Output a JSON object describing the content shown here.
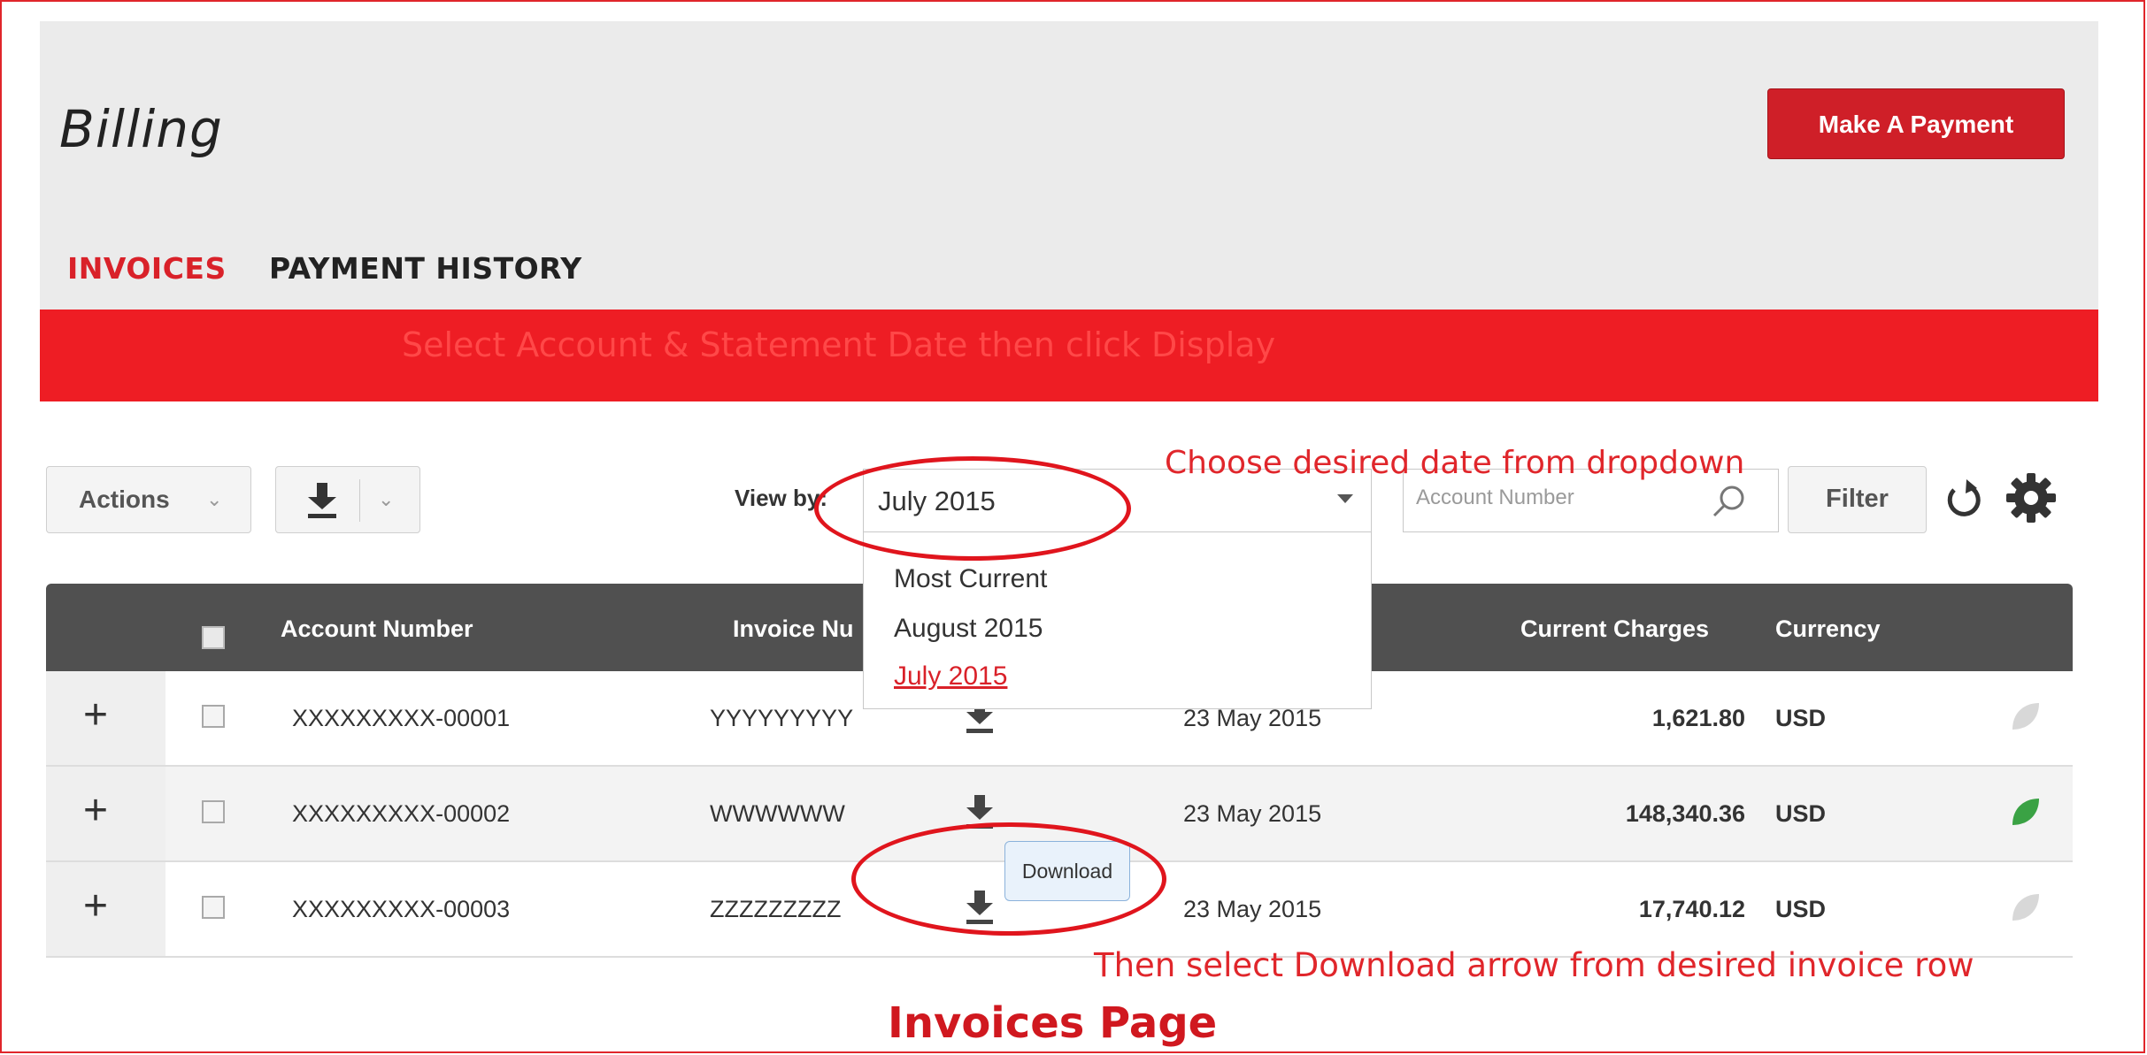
{
  "page": {
    "title": "Billing",
    "make_payment_label": "Make A Payment",
    "tabs": [
      {
        "label": "INVOICES",
        "active": true
      },
      {
        "label": "PAYMENT HISTORY",
        "active": false
      }
    ],
    "banner_text": "Select Account & Statement Date then click Display",
    "accent_color": "#ee1d24"
  },
  "toolbar": {
    "actions_label": "Actions",
    "view_by_label": "View by:",
    "selected_date": "July 2015",
    "date_options": [
      "Most Current",
      "August 2015",
      "July 2015"
    ],
    "search_placeholder": "Account Number",
    "filter_label": "Filter",
    "icons": [
      "chevron-down-icon",
      "download-icon",
      "search-icon",
      "refresh-icon",
      "gear-icon"
    ]
  },
  "table": {
    "headers": [
      "Account Number",
      "Invoice Nu",
      "Current Charges",
      "Currency"
    ],
    "rows": [
      {
        "account": "XXXXXXXXX-00001",
        "invoice": "YYYYYYYYY",
        "date": "23 May 2015",
        "charges": "1,621.80",
        "currency": "USD",
        "leaf_active": false
      },
      {
        "account": "XXXXXXXXX-00002",
        "invoice": "WWWWWW",
        "date": "23 May 2015",
        "charges": "148,340.36",
        "currency": "USD",
        "leaf_active": true
      },
      {
        "account": "XXXXXXXXX-00003",
        "invoice": "ZZZZZZZZZ",
        "date": "23 May 2015",
        "charges": "17,740.12",
        "currency": "USD",
        "leaf_active": false
      }
    ],
    "tooltip": "Download",
    "leaf_active_color": "#3aa244",
    "leaf_inactive_color": "#d8d8d8"
  },
  "annotations": {
    "dropdown_hint": "Choose desired date from dropdown",
    "download_hint": "Then select Download arrow from desired invoice row",
    "caption": "Invoices Page"
  }
}
